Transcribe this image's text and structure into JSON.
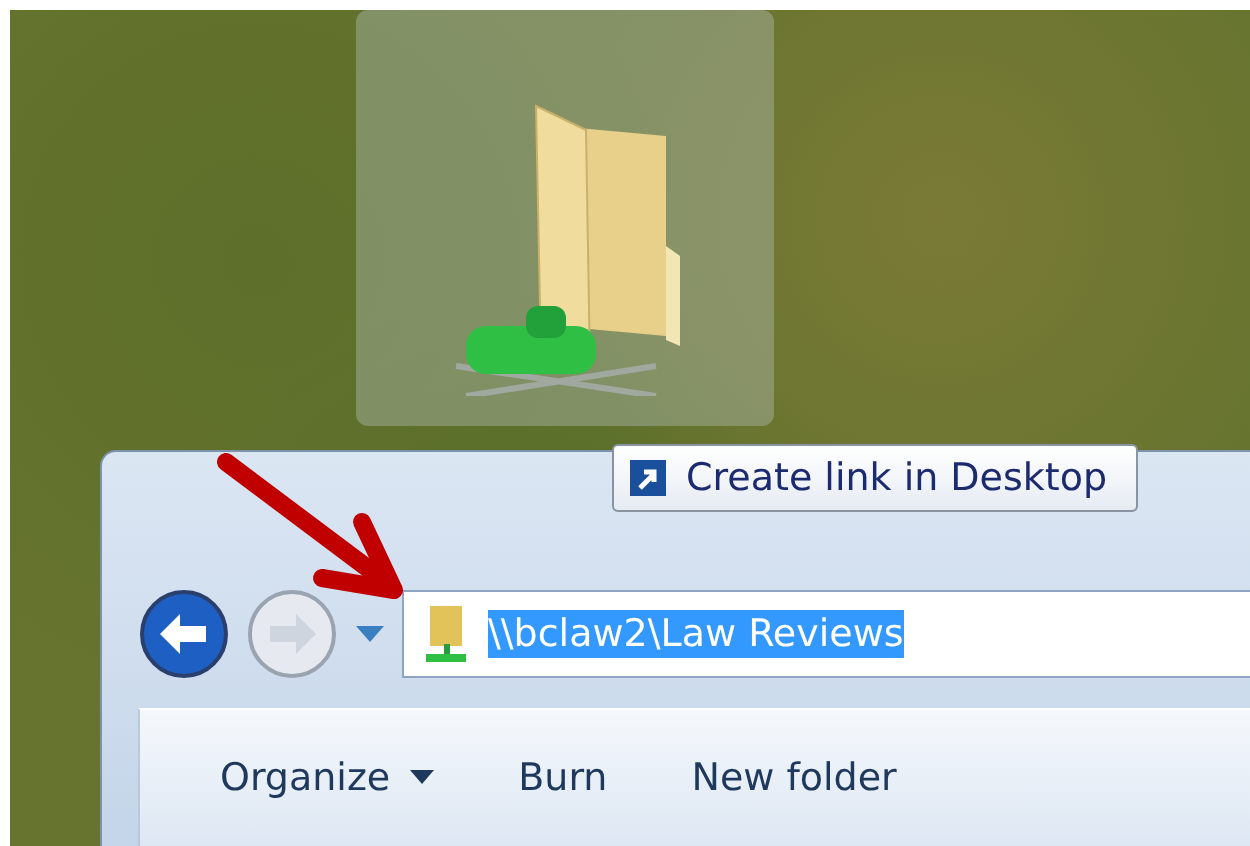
{
  "tooltip": {
    "text": "Create link in Desktop"
  },
  "address_bar": {
    "value": "\\\\bclaw2\\Law Reviews",
    "selected": true
  },
  "toolbar": [
    {
      "label": "Organize",
      "has_menu": true
    },
    {
      "label": "Burn",
      "has_menu": false
    },
    {
      "label": "New folder",
      "has_menu": false
    }
  ]
}
